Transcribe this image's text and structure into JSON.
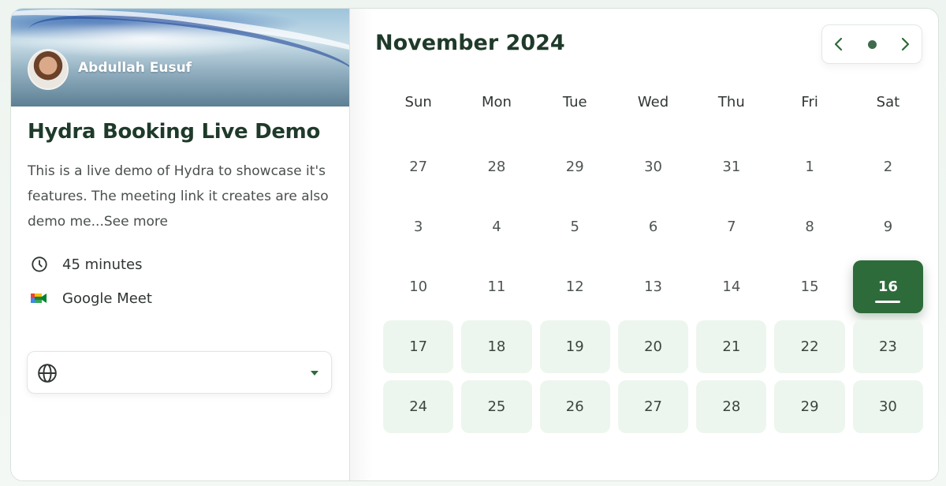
{
  "host": {
    "name": "Abdullah Eusuf",
    "avatar": "avatar-photo"
  },
  "event": {
    "title": "Hydra Booking Live Demo",
    "description": "This is a live demo of Hydra to showcase it's features. The meeting link it creates are also demo me...",
    "see_more": "See more",
    "duration": "45 minutes",
    "duration_icon": "clock-icon",
    "location": "Google Meet",
    "location_icon": "google-meet-icon"
  },
  "timezone": {
    "icon": "globe-icon",
    "value": ""
  },
  "calendar": {
    "month_label": "November 2024",
    "nav": {
      "prev": "chevron-left-icon",
      "today": "dot-icon",
      "next": "chevron-right-icon"
    },
    "weekdays": [
      "Sun",
      "Mon",
      "Tue",
      "Wed",
      "Thu",
      "Fri",
      "Sat"
    ],
    "weeks": [
      [
        {
          "d": "27",
          "s": "other"
        },
        {
          "d": "28",
          "s": "other"
        },
        {
          "d": "29",
          "s": "other"
        },
        {
          "d": "30",
          "s": "other"
        },
        {
          "d": "31",
          "s": "other"
        },
        {
          "d": "1",
          "s": "past"
        },
        {
          "d": "2",
          "s": "past"
        }
      ],
      [
        {
          "d": "3",
          "s": "past"
        },
        {
          "d": "4",
          "s": "past"
        },
        {
          "d": "5",
          "s": "past"
        },
        {
          "d": "6",
          "s": "past"
        },
        {
          "d": "7",
          "s": "past"
        },
        {
          "d": "8",
          "s": "past"
        },
        {
          "d": "9",
          "s": "past"
        }
      ],
      [
        {
          "d": "10",
          "s": "past"
        },
        {
          "d": "11",
          "s": "past"
        },
        {
          "d": "12",
          "s": "past"
        },
        {
          "d": "13",
          "s": "past"
        },
        {
          "d": "14",
          "s": "past"
        },
        {
          "d": "15",
          "s": "past"
        },
        {
          "d": "16",
          "s": "selected"
        }
      ],
      [
        {
          "d": "17",
          "s": "avail"
        },
        {
          "d": "18",
          "s": "avail"
        },
        {
          "d": "19",
          "s": "avail"
        },
        {
          "d": "20",
          "s": "avail"
        },
        {
          "d": "21",
          "s": "avail"
        },
        {
          "d": "22",
          "s": "avail"
        },
        {
          "d": "23",
          "s": "avail"
        }
      ],
      [
        {
          "d": "24",
          "s": "avail"
        },
        {
          "d": "25",
          "s": "avail"
        },
        {
          "d": "26",
          "s": "avail"
        },
        {
          "d": "27",
          "s": "avail"
        },
        {
          "d": "28",
          "s": "avail"
        },
        {
          "d": "29",
          "s": "avail"
        },
        {
          "d": "30",
          "s": "avail"
        }
      ]
    ],
    "selected_day": "16",
    "colors": {
      "accent": "#2e6b3a",
      "available_bg": "#edf6ee",
      "heading": "#1f3a2a"
    }
  }
}
